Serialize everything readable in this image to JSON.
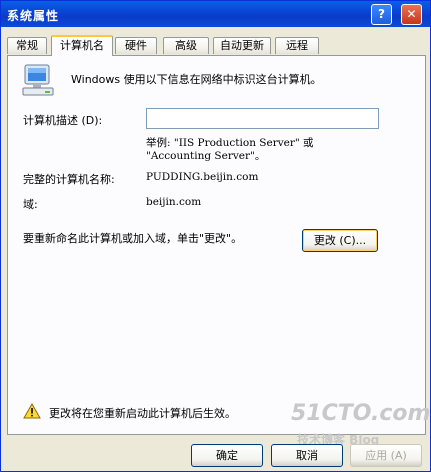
{
  "window": {
    "title": "系统属性"
  },
  "titlebar": {
    "help_glyph": "?",
    "close_glyph": "✕"
  },
  "tabs": [
    {
      "label": "常规",
      "active": false
    },
    {
      "label": "计算机名",
      "active": true
    },
    {
      "label": "硬件",
      "active": false
    },
    {
      "label": "高级",
      "active": false
    },
    {
      "label": "自动更新",
      "active": false
    },
    {
      "label": "远程",
      "active": false
    }
  ],
  "panel": {
    "intro_text": "Windows 使用以下信息在网络中标识这台计算机。",
    "description_label": "计算机描述 (D):",
    "description_value": "",
    "example_line1": "举例: \"IIS Production Server\" 或",
    "example_line2": "\"Accounting Server\"。",
    "full_name_label": "完整的计算机名称:",
    "full_name_value": "PUDDING.beijin.com",
    "domain_label": "域:",
    "domain_value": "beijin.com",
    "rename_text": "要重新命名此计算机或加入域，单击\"更改\"。",
    "change_button": "更改 (C)...",
    "warning_text": "更改将在您重新启动此计算机后生效。"
  },
  "footer": {
    "ok_label": "确定",
    "cancel_label": "取消",
    "apply_label": "应用 (A)"
  },
  "watermark": {
    "line1": "51CTO.com",
    "line2": "技术博客 Blog"
  },
  "colors": {
    "title_bar": "#0a4ad8",
    "window_bg": "#ece9d8",
    "tab_highlight": "#ffc83c",
    "button_border": "#003c74"
  }
}
